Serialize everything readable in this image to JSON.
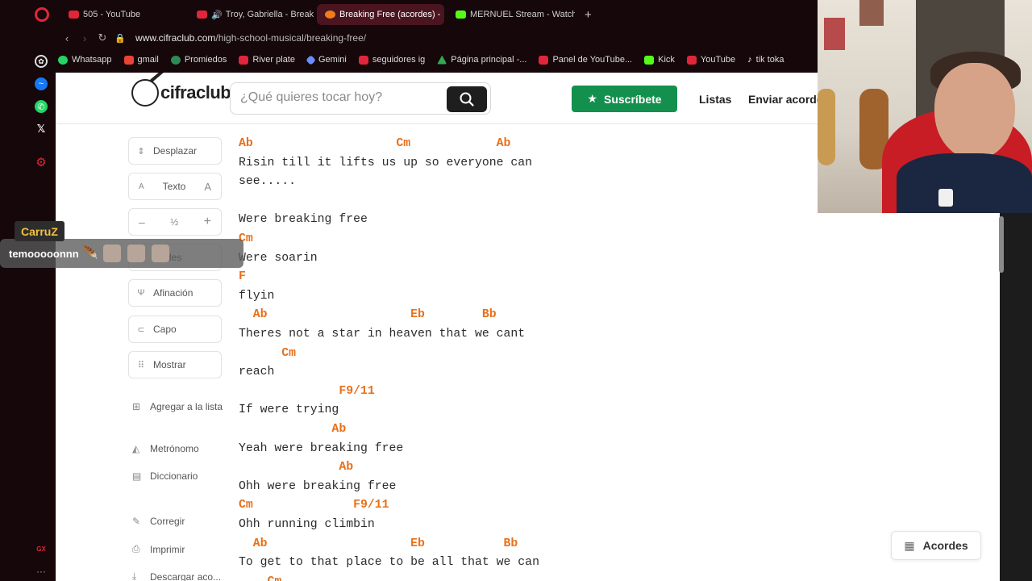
{
  "browser": {
    "tabs": [
      {
        "label": "505 - YouTube",
        "color": "#e0263b",
        "active": false
      },
      {
        "label": "Troy, Gabriella - Break",
        "color": "#e0263b",
        "active": false
      },
      {
        "label": "Breaking Free (acordes) -",
        "color": "#f07c1c",
        "active": true
      },
      {
        "label": "MERNUEL Stream - Watch",
        "color": "#53fc18",
        "active": false
      }
    ],
    "url_domain": "www.cifraclub.com",
    "url_path": "/high-school-musical/breaking-free/",
    "bookmarks": [
      {
        "label": "Whatsapp",
        "color": "#25d366"
      },
      {
        "label": "gmail",
        "color": "#ea4335"
      },
      {
        "label": "Promiedos",
        "color": "#2e8b57"
      },
      {
        "label": "River plate",
        "color": "#e0263b"
      },
      {
        "label": "Gemini",
        "color": "#6b8cff"
      },
      {
        "label": "seguidores ig",
        "color": "#e0263b"
      },
      {
        "label": "Página principal -...",
        "color": "#34a853"
      },
      {
        "label": "Panel de YouTube...",
        "color": "#e0263b"
      },
      {
        "label": "Kick",
        "color": "#53fc18"
      },
      {
        "label": "YouTube",
        "color": "#e0263b"
      },
      {
        "label": "tik toka",
        "color": "#ffffff"
      }
    ]
  },
  "header": {
    "logo_text": "cifraclub",
    "search_placeholder": "¿Qué quieres tocar hoy?",
    "subscribe_label": "Suscríbete",
    "lists_label": "Listas",
    "send_label": "Enviar acorde"
  },
  "tools": {
    "scroll": "Desplazar",
    "text": "Texto",
    "text_small": "A",
    "text_big": "A",
    "half": "½",
    "minus": "–",
    "plus": "+",
    "chords_partial": "des",
    "tuning": "Afinación",
    "capo": "Capo",
    "show": "Mostrar",
    "add_list": "Agregar a la lista",
    "metronome": "Metrónomo",
    "dictionary": "Diccionario",
    "correct": "Corregir",
    "print": "Imprimir",
    "download": "Descargar aco..."
  },
  "sheet": [
    {
      "type": "chord",
      "text": "Ab                    Cm            Ab"
    },
    {
      "type": "lyric",
      "text": "Risin till it lifts us up so everyone can"
    },
    {
      "type": "lyric",
      "text": "see....."
    },
    {
      "type": "lyric",
      "text": ""
    },
    {
      "type": "lyric",
      "text": "Were breaking free"
    },
    {
      "type": "chord",
      "text": "Cm"
    },
    {
      "type": "lyric",
      "text": "Were soarin"
    },
    {
      "type": "chord",
      "text": "F"
    },
    {
      "type": "lyric",
      "text": "flyin"
    },
    {
      "type": "chord",
      "text": "  Ab                    Eb        Bb"
    },
    {
      "type": "lyric",
      "text": "Theres not a star in heaven that we cant"
    },
    {
      "type": "chord",
      "text": "      Cm"
    },
    {
      "type": "lyric",
      "text": "reach"
    },
    {
      "type": "chord",
      "text": "              F9/11"
    },
    {
      "type": "lyric",
      "text": "If were trying"
    },
    {
      "type": "chord",
      "text": "             Ab"
    },
    {
      "type": "lyric",
      "text": "Yeah were breaking free"
    },
    {
      "type": "chord",
      "text": "              Ab"
    },
    {
      "type": "lyric",
      "text": "Ohh were breaking free"
    },
    {
      "type": "chord",
      "text": "Cm              F9/11"
    },
    {
      "type": "lyric",
      "text": "Ohh running climbin"
    },
    {
      "type": "chord",
      "text": "  Ab                    Eb           Bb"
    },
    {
      "type": "lyric",
      "text": "To get to that place to be all that we can"
    },
    {
      "type": "chord",
      "text": "    Cm"
    }
  ],
  "acordes_button": "Acordes",
  "stream_overlay": {
    "username": "CarruZ",
    "message": "temooooonnn"
  },
  "colors": {
    "chord": "#e8701a",
    "subscribe": "#14904e",
    "browser_bg": "#15070a",
    "active_tab": "#4a1520"
  }
}
